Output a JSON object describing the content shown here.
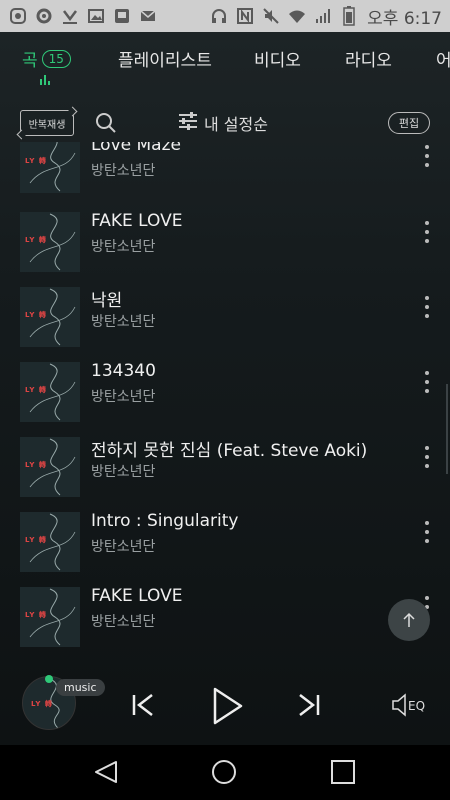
{
  "status_bar": {
    "time": "오후 6:17",
    "left_icons": [
      "app-icon",
      "settings-icon",
      "download-icon",
      "image-icon",
      "message-icon",
      "mail-icon"
    ],
    "right_icons": [
      "headphones-icon",
      "nfc-icon",
      "mute-icon",
      "wifi-icon",
      "signal-icon",
      "battery-icon"
    ]
  },
  "tabs": [
    {
      "label": "곡",
      "active": true,
      "count": "15"
    },
    {
      "label": "플레이리스트",
      "active": false
    },
    {
      "label": "비디오",
      "active": false
    },
    {
      "label": "라디오",
      "active": false
    },
    {
      "label": "어",
      "active": false
    }
  ],
  "toolbar": {
    "repeat_label": "반복재생",
    "sort_label": "내 설정순",
    "edit_label": "편집"
  },
  "songs": [
    {
      "title": "Love Maze",
      "artist": "방탄소년단"
    },
    {
      "title": "FAKE LOVE",
      "artist": "방탄소년단"
    },
    {
      "title": "낙원",
      "artist": "방탄소년단"
    },
    {
      "title": "134340",
      "artist": "방탄소년단"
    },
    {
      "title": "전하지 못한 진심 (Feat. Steve Aoki)",
      "artist": "방탄소년단"
    },
    {
      "title": "Intro : Singularity",
      "artist": "방탄소년단"
    },
    {
      "title": "FAKE LOVE",
      "artist": "방탄소년단"
    }
  ],
  "album_art_text": "LY 轉",
  "player": {
    "badge": "music"
  },
  "colors": {
    "accent": "#2fc878",
    "background": "#151b1d"
  }
}
